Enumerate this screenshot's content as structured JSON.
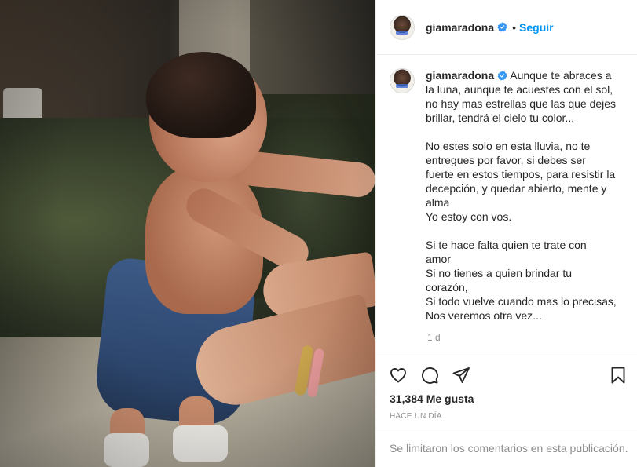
{
  "post": {
    "author": {
      "username": "giamaradona",
      "verified_icon": "verified-badge-icon",
      "follow_separator": "•",
      "follow_label": "Seguir"
    },
    "caption": {
      "username": "giamaradona",
      "lines": [
        "Aunque te abraces a",
        "la luna, aunque te acuestes con el sol,",
        "no hay mas estrellas que las que dejes",
        "brillar, tendrá el cielo tu color...",
        "",
        "No estes solo en esta lluvia, no te",
        "entregues por favor, si debes ser",
        "fuerte en estos tiempos, para resistir la",
        "decepción, y quedar abierto, mente y",
        "alma",
        "Yo estoy con vos.",
        "",
        "Si te hace falta quien te trate con",
        "amor",
        "Si no tienes a quien brindar tu",
        "corazón,",
        "Si todo vuelve cuando mas lo precisas,",
        "Nos veremos otra vez..."
      ],
      "time_ago": "1 d"
    },
    "actions": {
      "like_icon": "heart-icon",
      "comment_icon": "comment-icon",
      "share_icon": "paper-plane-icon",
      "save_icon": "bookmark-icon"
    },
    "likes_text": "31,384 Me gusta",
    "posted_text": "HACE UN DÍA",
    "comments_disabled_text": "Se limitaron los comentarios en esta publicación."
  },
  "colors": {
    "accent": "#0095f6",
    "text": "#262626",
    "muted": "#8e8e8e",
    "border": "#efefef"
  }
}
